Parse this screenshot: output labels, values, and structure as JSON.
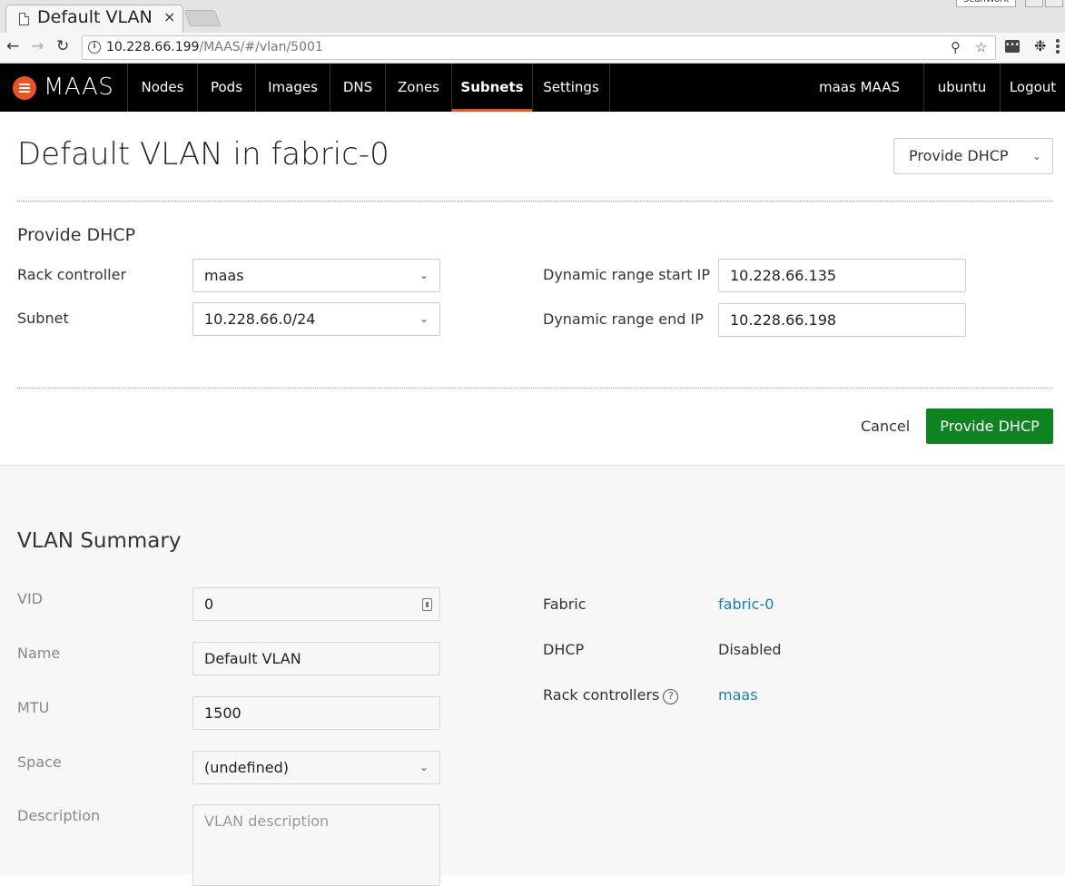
{
  "browser": {
    "tab_title": "Default VLAN",
    "tab_close": "×",
    "profile": "SeanWork",
    "url_host": "10.228.66.199",
    "url_path": "/MAAS/#/vlan/5001",
    "icons": [
      "back-icon",
      "forward-icon",
      "reload-icon",
      "info-icon",
      "zoom-icon",
      "star-icon",
      "extension-icon",
      "gimp-icon",
      "menu-icon"
    ]
  },
  "nav": {
    "brand": "MAAS",
    "items": [
      "Nodes",
      "Pods",
      "Images",
      "DNS",
      "Zones",
      "Subnets",
      "Settings"
    ],
    "active": "Subnets",
    "user": "maas MAAS",
    "account": "ubuntu",
    "logout": "Logout"
  },
  "page": {
    "title": "Default VLAN in fabric-0",
    "action_button": "Provide DHCP"
  },
  "dhcp_form": {
    "title": "Provide DHCP",
    "rack_controller_label": "Rack controller",
    "rack_controller_value": "maas",
    "subnet_label": "Subnet",
    "subnet_value": "10.228.66.0/24",
    "start_ip_label": "Dynamic range start IP",
    "start_ip_value": "10.228.66.135",
    "end_ip_label": "Dynamic range end IP",
    "end_ip_value": "10.228.66.198",
    "cancel": "Cancel",
    "submit": "Provide DHCP"
  },
  "summary": {
    "title": "VLAN Summary",
    "vid_label": "VID",
    "vid_value": "0",
    "name_label": "Name",
    "name_value": "Default VLAN",
    "mtu_label": "MTU",
    "mtu_value": "1500",
    "space_label": "Space",
    "space_value": "(undefined)",
    "description_label": "Description",
    "description_placeholder": "VLAN description",
    "fabric_label": "Fabric",
    "fabric_value": "fabric-0",
    "dhcp_label": "DHCP",
    "dhcp_value": "Disabled",
    "rack_label": "Rack controllers",
    "rack_value": "maas",
    "help_glyph": "?"
  }
}
